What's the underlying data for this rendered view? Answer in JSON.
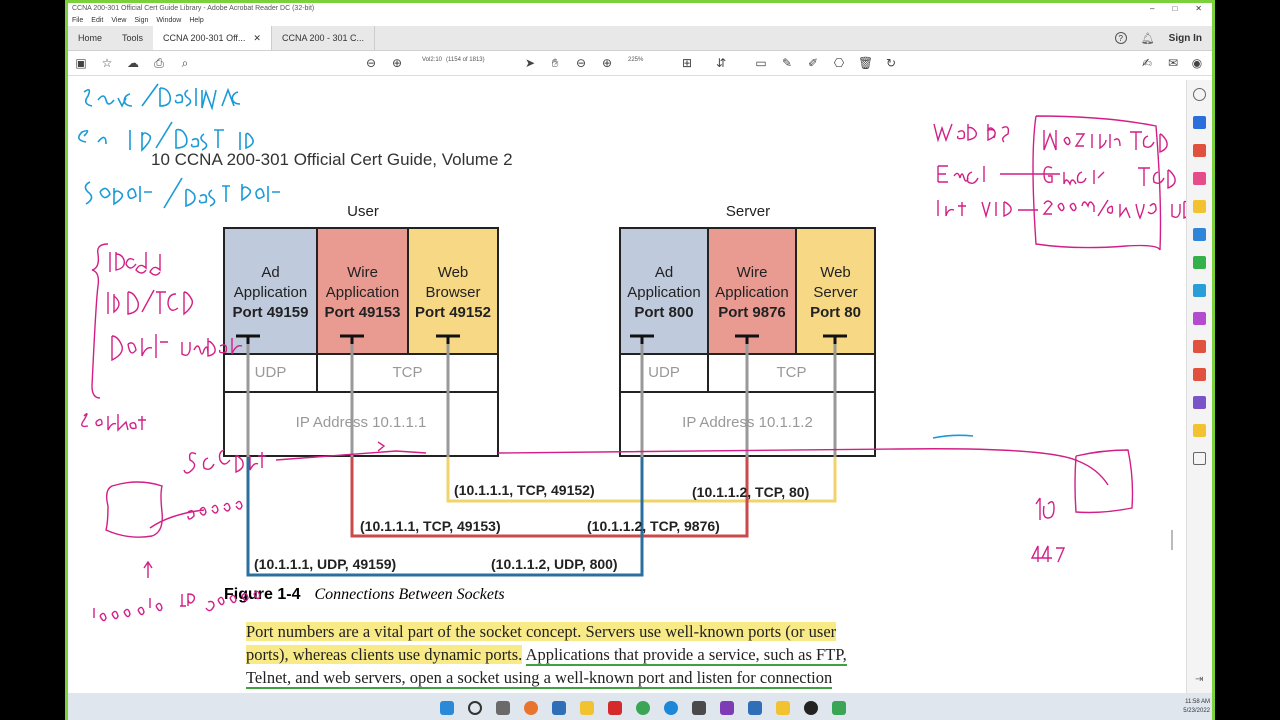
{
  "window": {
    "title": "CCNA 200-301 Official Cert Guide Library - Adobe Acrobat Reader DC (32-bit)",
    "menu": [
      "File",
      "Edit",
      "View",
      "Sign",
      "Window",
      "Help"
    ]
  },
  "tabs": {
    "home": "Home",
    "tools": "Tools",
    "doc1": "CCNA 200-301 Off...",
    "doc2": "CCNA 200 - 301 C...",
    "sign_in": "Sign In"
  },
  "toolbar": {
    "page_label": "Vol2:10",
    "page_count": "(1154 of 1813)",
    "zoom": "225%"
  },
  "page": {
    "book_title": "10 CCNA 200-301 Official Cert Guide, Volume 2",
    "user_label": "User",
    "server_label": "Server",
    "user": {
      "ad": [
        "Ad",
        "Application",
        "Port 49159"
      ],
      "wire": [
        "Wire",
        "Application",
        "Port 49153"
      ],
      "web": [
        "Web",
        "Browser",
        "Port 49152"
      ],
      "udp": "UDP",
      "tcp": "TCP",
      "ip": "IP Address 10.1.1.1"
    },
    "server": {
      "ad": [
        "Ad",
        "Application",
        "Port 800"
      ],
      "wire": [
        "Wire",
        "Application",
        "Port 9876"
      ],
      "web": [
        "Web",
        "Server",
        "Port 80"
      ],
      "udp": "UDP",
      "tcp": "TCP",
      "ip": "IP Address 10.1.1.2"
    },
    "connections": {
      "web_client": "(10.1.1.1, TCP, 49152)",
      "web_server": "(10.1.1.2, TCP, 80)",
      "wire_client": "(10.1.1.1, TCP, 49153)",
      "wire_server": "(10.1.1.2, TCP, 9876)",
      "ad_client": "(10.1.1.1, UDP, 49159)",
      "ad_server": "(10.1.1.2, UDP, 800)"
    },
    "figure_number": "Figure 1-4",
    "figure_caption": "Connections Between Sockets",
    "paragraph": {
      "hl1": "Port numbers are a vital part of the socket concept. Servers use well-known ports (or user",
      "hl2": "ports), whereas clients use dynamic ports.",
      "ul1": "Applications that provide a service, such as FTP,",
      "ul2": "Telnet, and web servers, open a socket using a well-known port and listen for connection"
    }
  },
  "clock": {
    "time": "11:58 AM",
    "date": "5/23/2022"
  },
  "colors": {
    "ink_blue": "#1a9ad6",
    "ink_pink": "#d21f86",
    "line_blue": "#2a6f9e",
    "line_red": "#c94a4a",
    "line_yellow": "#f2d36b",
    "highlight": "#f8ea87"
  }
}
